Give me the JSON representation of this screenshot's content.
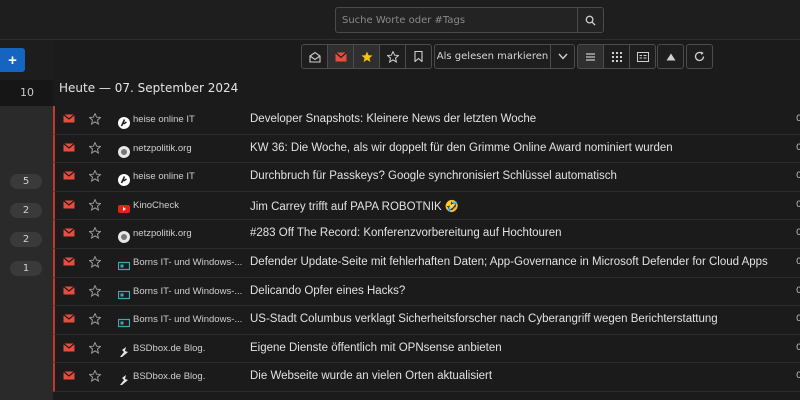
{
  "search": {
    "placeholder": "Suche Worte oder #Tags"
  },
  "sidebar": {
    "add_label": "+",
    "current_count": "10",
    "badges": [
      "5",
      "2",
      "2",
      "1"
    ]
  },
  "toolbar": {
    "mark_read_label": "Als gelesen markieren"
  },
  "day_header": "Heute — 07. September 2024",
  "colors": {
    "accent": "#1565c0",
    "unread": "#e74c3c",
    "star_active": "#f1c40f"
  },
  "articles": [
    {
      "feed": "heise online IT",
      "feed_icon": "heise-icon",
      "title": "Developer Snapshots: Kleinere News der letzten Woche",
      "tail": "0"
    },
    {
      "feed": "netzpolitik.org",
      "feed_icon": "netzpolitik-icon",
      "title": "KW 36: Die Woche, als wir doppelt für den Grimme Online Award nominiert wurden",
      "tail": "0"
    },
    {
      "feed": "heise online IT",
      "feed_icon": "heise-icon",
      "title": "Durchbruch für Passkeys? Google synchronisiert Schlüssel automatisch",
      "tail": "0"
    },
    {
      "feed": "KinoCheck",
      "feed_icon": "youtube-icon",
      "title": "Jim Carrey trifft auf PAPA ROBOTNIK 🤣",
      "tail": "0"
    },
    {
      "feed": "netzpolitik.org",
      "feed_icon": "netzpolitik-icon",
      "title": "#283 Off The Record: Konferenzvorbereitung auf Hochtouren",
      "tail": "0"
    },
    {
      "feed": "Borns IT- und Windows-...",
      "feed_icon": "borns-icon",
      "title": "Defender Update-Seite mit fehlerhaften Daten; App-Governance in Microsoft Defender for Cloud Apps",
      "tail": "0"
    },
    {
      "feed": "Borns IT- und Windows-...",
      "feed_icon": "borns-icon",
      "title": "Delicando Opfer eines Hacks?",
      "tail": "0"
    },
    {
      "feed": "Borns IT- und Windows-...",
      "feed_icon": "borns-icon",
      "title": "US-Stadt Columbus verklagt Sicherheitsforscher nach Cyberangriff wegen Berichterstattung",
      "tail": "0"
    },
    {
      "feed": "BSDbox.de Blog.",
      "feed_icon": "bsdbox-icon",
      "title": "Eigene Dienste öffentlich mit OPNsense anbieten",
      "tail": "0"
    },
    {
      "feed": "BSDbox.de Blog.",
      "feed_icon": "bsdbox-icon",
      "title": "Die Webseite wurde an vielen Orten aktualisiert",
      "tail": "0"
    }
  ]
}
